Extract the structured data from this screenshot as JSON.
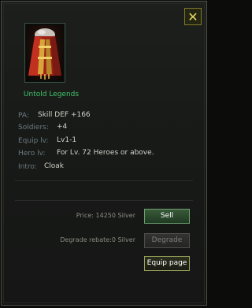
{
  "item": {
    "name": "Untold Legends",
    "icon": "cloak-icon"
  },
  "stats": [
    {
      "label": "PA:",
      "value": "Skill DEF +166"
    },
    {
      "label": "Soldiers:",
      "value": "+4"
    },
    {
      "label": "Equip lv:",
      "value": "Lv1-1"
    },
    {
      "label": "Hero lv:",
      "value": "For Lv. 72 Heroes or above."
    },
    {
      "label": "Intro:",
      "value": "Cloak"
    }
  ],
  "actions": {
    "price_label": "Price: 14250 Silver",
    "sell_label": "Sell",
    "degrade_rebate_label": "Degrade rebate:0 Silver",
    "degrade_label": "Degrade",
    "equip_page_label": "Equip page"
  },
  "close": {
    "glyph": "✕"
  },
  "colors": {
    "item_name": "#42c46a",
    "accent_gold": "#e4d76a",
    "sell_button": "#2f5030"
  }
}
